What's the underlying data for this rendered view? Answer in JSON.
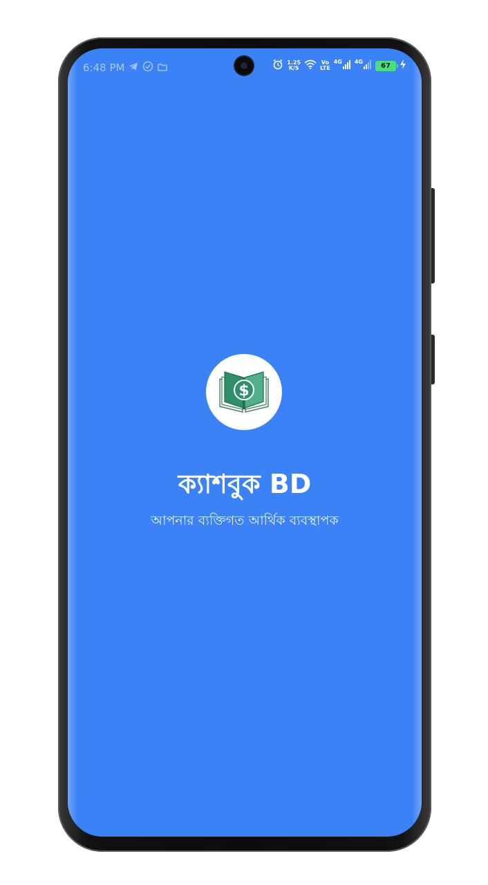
{
  "status_bar": {
    "time": "6:48 PM",
    "speed_value": "1.25",
    "speed_unit": "K/S",
    "volte_top": "Vo",
    "volte_bottom": "LTE",
    "network_1": "4G",
    "network_2": "4G",
    "battery_level": "67",
    "icons": [
      "telegram-icon",
      "check-circle-icon",
      "folder-icon",
      "alarm-icon",
      "wifi-icon",
      "signal-icon",
      "charging-icon"
    ]
  },
  "splash": {
    "app_name": "ক্যাশবুক BD",
    "tagline": "আপনার ব্যক্তিগত আর্থিক ব্যবস্থাপক",
    "logo_icon": "money-book-icon",
    "logo_symbol": "$"
  },
  "colors": {
    "background": "#3b82f6",
    "logo_bg": "#ffffff",
    "book_green": "#2f8f6b",
    "text": "#ffffff"
  }
}
